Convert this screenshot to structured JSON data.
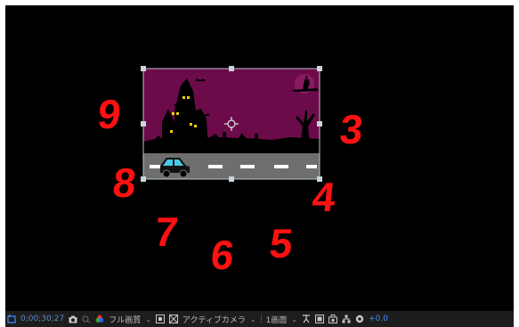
{
  "canvas_labels": [
    "9",
    "3",
    "8",
    "4",
    "7",
    "6",
    "5"
  ],
  "statusbar": {
    "timecode": "0;00;30;27",
    "resolution": "フル画質",
    "camera": "アクティブカメラ",
    "views": "1画面",
    "exposure": "+0.0"
  },
  "icons": [
    "composition-icon",
    "camera-snapshot-icon",
    "show-snapshot-icon",
    "color-channel-icon",
    "region-of-interest-icon",
    "transparency-grid-icon",
    "fast-preview-icon",
    "toggle-mask-icon",
    "draft-3d-icon",
    "flowchart-icon",
    "reset-exposure-icon"
  ],
  "colors": {
    "number_red": "#ff1111",
    "sky_purple": "#6c0b4a",
    "road_grey": "#6e6e6e",
    "exposure_blue": "#3d8fff"
  }
}
